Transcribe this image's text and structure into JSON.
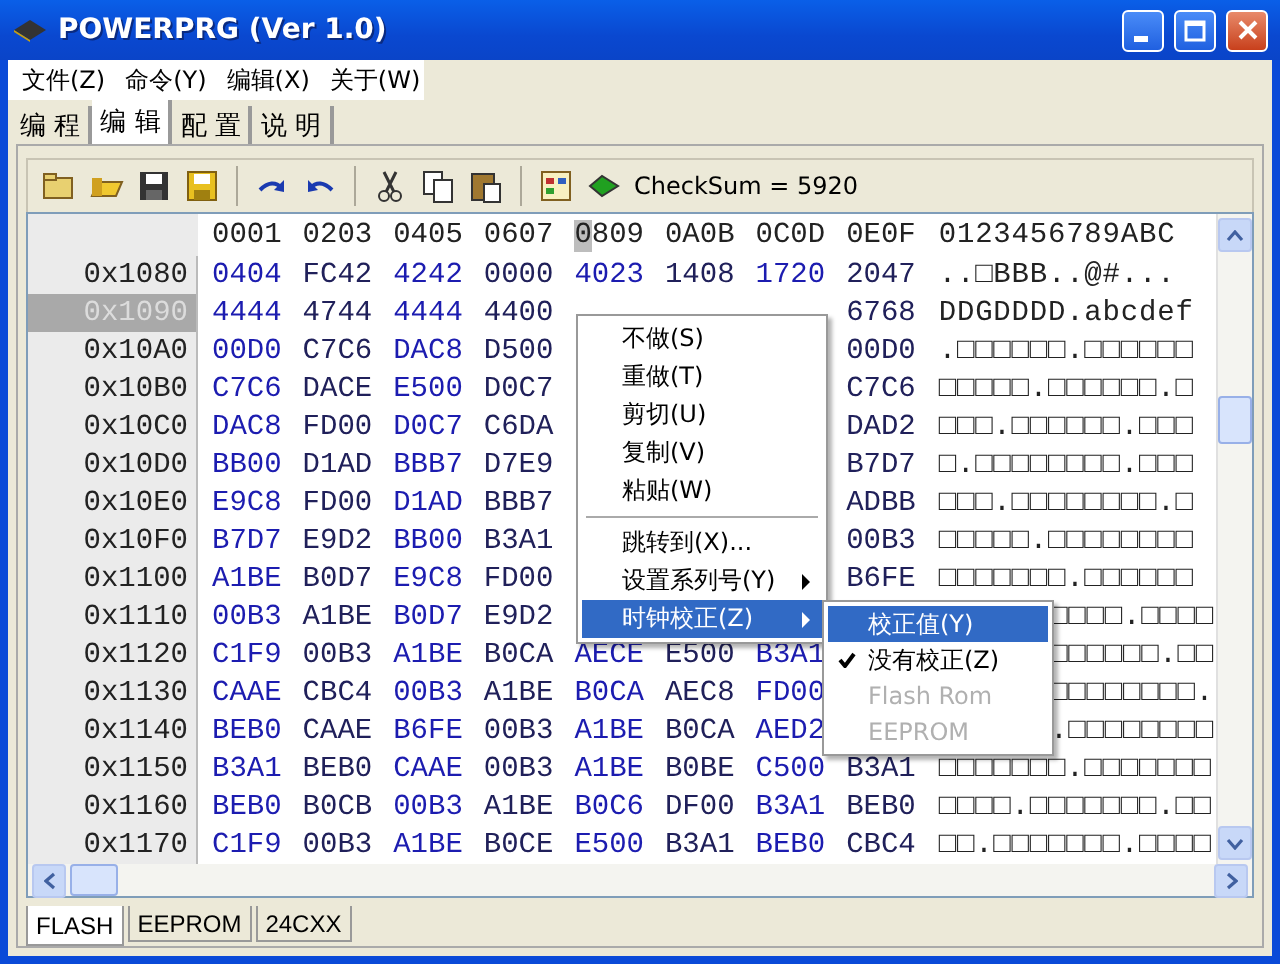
{
  "window": {
    "title": "POWERPRG (Ver 1.0)"
  },
  "menu_bar": [
    "文件(Z)",
    "命令(Y)",
    "编辑(X)",
    "关于(W)"
  ],
  "tabs": [
    {
      "label": "编 程",
      "selected": false
    },
    {
      "label": "编 辑",
      "selected": true
    },
    {
      "label": "配 置",
      "selected": false
    },
    {
      "label": "说 明",
      "selected": false
    }
  ],
  "toolbar": {
    "checksum": "CheckSum = 5920"
  },
  "grid": {
    "columns": [
      {
        "label": "0001",
        "selected": false
      },
      {
        "label": "0203",
        "selected": false
      },
      {
        "label": "0405",
        "selected": false
      },
      {
        "label": "0607",
        "selected": false
      },
      {
        "label": "0809",
        "selected": true
      },
      {
        "label": "0A0B",
        "selected": false
      },
      {
        "label": "0C0D",
        "selected": false
      },
      {
        "label": "0E0F",
        "selected": false
      }
    ],
    "ascii_header": "0123456789ABC",
    "rows": [
      {
        "address": "0x1080",
        "selected": false,
        "cells": [
          "0404",
          "FC42",
          "4242",
          "0000",
          "4023",
          "1408",
          "1720",
          "2047"
        ],
        "ascii": "..□BBB..@#...",
        "ascii_covered": false
      },
      {
        "address": "0x1090",
        "selected": true,
        "cells": [
          "4444",
          "4744",
          "4444",
          "4400",
          null,
          null,
          null,
          "6768"
        ],
        "ascii": "DDGDDDD.abcdef",
        "ascii_covered": false
      },
      {
        "address": "0x10A0",
        "selected": false,
        "cells": [
          "00D0",
          "C7C6",
          "DAC8",
          "D500",
          null,
          null,
          null,
          "00D0"
        ],
        "ascii": ".□□□□□□.□□□□□□",
        "ascii_covered": false
      },
      {
        "address": "0x10B0",
        "selected": false,
        "cells": [
          "C7C6",
          "DACE",
          "E500",
          "D0C7",
          null,
          null,
          null,
          "C7C6"
        ],
        "ascii": "□□□□□.□□□□□□.□",
        "ascii_covered": false
      },
      {
        "address": "0x10C0",
        "selected": false,
        "cells": [
          "DAC8",
          "FD00",
          "D0C7",
          "C6DA",
          null,
          null,
          null,
          "DAD2"
        ],
        "ascii": "□□□.□□□□□□.□□□",
        "ascii_covered": false
      },
      {
        "address": "0x10D0",
        "selected": false,
        "cells": [
          "BB00",
          "D1AD",
          "BBB7",
          "D7E9",
          null,
          null,
          null,
          "B7D7"
        ],
        "ascii": "□.□□□□□□□□.□□□",
        "ascii_covered": false
      },
      {
        "address": "0x10E0",
        "selected": false,
        "cells": [
          "E9C8",
          "FD00",
          "D1AD",
          "BBB7",
          null,
          null,
          null,
          "ADBB"
        ],
        "ascii": "□□□.□□□□□□□□.□",
        "ascii_covered": false
      },
      {
        "address": "0x10F0",
        "selected": false,
        "cells": [
          "B7D7",
          "E9D2",
          "BB00",
          "B3A1",
          null,
          null,
          null,
          "00B3"
        ],
        "ascii": "□□□□□.□□□□□□□□",
        "ascii_covered": false
      },
      {
        "address": "0x1100",
        "selected": false,
        "cells": [
          "A1BE",
          "B0D7",
          "E9C8",
          "FD00",
          null,
          null,
          null,
          "B6FE"
        ],
        "ascii": "□□□□□□□.□□□□□□",
        "ascii_covered": false
      },
      {
        "address": "0x1110",
        "selected": false,
        "cells": [
          "00B3",
          "A1BE",
          "B0D7",
          "E9D2",
          null,
          null,
          null,
          null
        ],
        "ascii": "□□□□.□□□□",
        "ascii_covered": true
      },
      {
        "address": "0x1120",
        "selected": false,
        "cells": [
          "C1F9",
          "00B3",
          "A1BE",
          "B0CA",
          "AECE",
          "E500",
          "B3A1",
          null
        ],
        "ascii": "□□□□□□.□□",
        "ascii_covered": true
      },
      {
        "address": "0x1130",
        "selected": false,
        "cells": [
          "CAAE",
          "CBC4",
          "00B3",
          "A1BE",
          "B0CA",
          "AEC8",
          "FD00",
          null
        ],
        "ascii": "□□□□□□□□.",
        "ascii_covered": true
      },
      {
        "address": "0x1140",
        "selected": false,
        "cells": [
          "BEB0",
          "CAAE",
          "B6FE",
          "00B3",
          "A1BE",
          "B0CA",
          "AED2",
          null
        ],
        "ascii": ".□□□□□□□□",
        "ascii_covered": true
      },
      {
        "address": "0x1150",
        "selected": false,
        "cells": [
          "B3A1",
          "BEB0",
          "CAAE",
          "00B3",
          "A1BE",
          "B0BE",
          "C500",
          "B3A1"
        ],
        "ascii": "□□□□□□□.□□□□□□□",
        "ascii_covered": false
      },
      {
        "address": "0x1160",
        "selected": false,
        "cells": [
          "BEB0",
          "B0CB",
          "00B3",
          "A1BE",
          "B0C6",
          "DF00",
          "B3A1",
          "BEB0"
        ],
        "ascii": "□□□□.□□□□□□□.□□",
        "ascii_covered": false
      },
      {
        "address": "0x1170",
        "selected": false,
        "cells": [
          "C1F9",
          "00B3",
          "A1BE",
          "B0CE",
          "E500",
          "B3A1",
          "BEB0",
          "CBC4"
        ],
        "ascii": "□□.□□□□□□□.□□□□",
        "ascii_covered": false
      }
    ]
  },
  "bottom_tabs": [
    {
      "label": "FLASH",
      "selected": true
    },
    {
      "label": "EEPROM",
      "selected": false
    },
    {
      "label": "24CXX",
      "selected": false
    }
  ],
  "context_menu": {
    "items": [
      {
        "kind": "item",
        "label": "不做(S)",
        "selected": false,
        "submenu": false
      },
      {
        "kind": "item",
        "label": "重做(T)",
        "selected": false,
        "submenu": false
      },
      {
        "kind": "item",
        "label": "剪切(U)",
        "selected": false,
        "submenu": false
      },
      {
        "kind": "item",
        "label": "复制(V)",
        "selected": false,
        "submenu": false
      },
      {
        "kind": "item",
        "label": "粘贴(W)",
        "selected": false,
        "submenu": false
      },
      {
        "kind": "separator"
      },
      {
        "kind": "item",
        "label": "跳转到(X)...",
        "selected": false,
        "submenu": false
      },
      {
        "kind": "item",
        "label": "设置系列号(Y)",
        "selected": false,
        "submenu": true
      },
      {
        "kind": "item",
        "label": "时钟校正(Z)",
        "selected": true,
        "submenu": true
      }
    ]
  },
  "submenu": {
    "items": [
      {
        "label": "校正值(Y)",
        "selected": true,
        "checked": false,
        "disabled": false
      },
      {
        "label": "没有校正(Z)",
        "selected": false,
        "checked": true,
        "disabled": false
      },
      {
        "label": "Flash Rom",
        "selected": false,
        "checked": false,
        "disabled": true
      },
      {
        "label": "EEPROM",
        "selected": false,
        "checked": false,
        "disabled": true
      }
    ]
  }
}
